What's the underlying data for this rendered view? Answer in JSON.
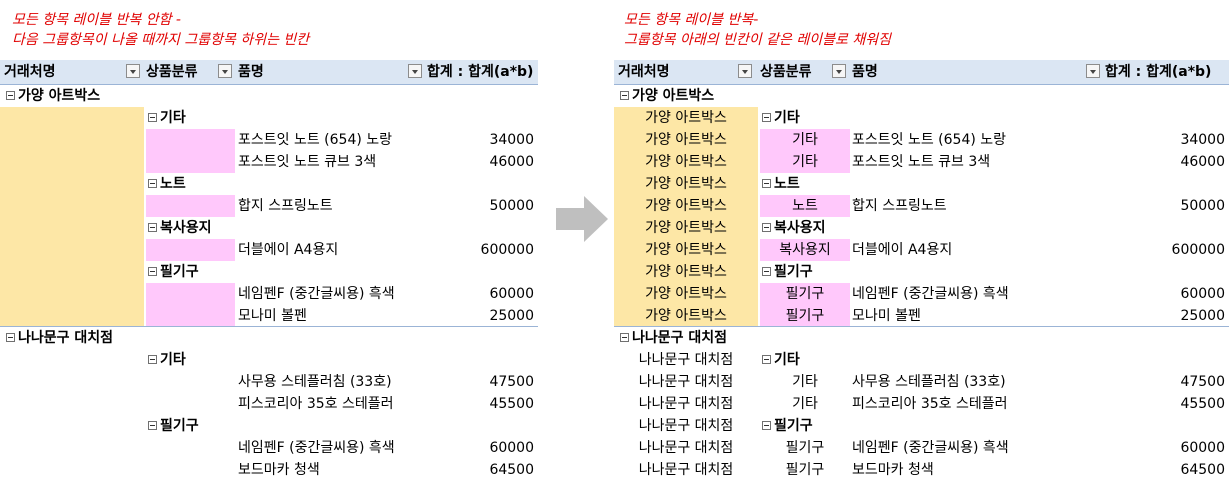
{
  "left_caption": {
    "line1": "모든 항목 레이블 반복 안함 -",
    "line2": "다음 그룹항목이 나올 때까지 그룹항목 하위는 빈칸"
  },
  "right_caption": {
    "line1": "모든 항목 레이블 반복-",
    "line2": "그룹항목 아래의 빈칸이 같은 레이블로 채워짐"
  },
  "headers": {
    "col1": "거래처명",
    "col2": "상품분류",
    "col3": "품명",
    "col4": "합계 : 합계(a*b)"
  },
  "colors": {
    "header_bg": "#dbe6f3",
    "vendor_fill": "#fde7a6",
    "category_fill": "#ffc8fb",
    "caption_text": "#e00000",
    "arrow": "#bfbfbf"
  },
  "arrow_icon": "right-arrow-icon",
  "left_rows": [
    {
      "vendor": "가양 아트박스",
      "category": "",
      "item": "",
      "value": ""
    },
    {
      "vendor": "",
      "category": "기타",
      "item": "",
      "value": ""
    },
    {
      "vendor": "",
      "category": "",
      "item": "포스트잇 노트 (654) 노랑",
      "value": "34000"
    },
    {
      "vendor": "",
      "category": "",
      "item": "포스트잇 노트 큐브 3색",
      "value": "46000"
    },
    {
      "vendor": "",
      "category": "노트",
      "item": "",
      "value": ""
    },
    {
      "vendor": "",
      "category": "",
      "item": "합지 스프링노트",
      "value": "50000"
    },
    {
      "vendor": "",
      "category": "복사용지",
      "item": "",
      "value": ""
    },
    {
      "vendor": "",
      "category": "",
      "item": "더블에이 A4용지",
      "value": "600000"
    },
    {
      "vendor": "",
      "category": "필기구",
      "item": "",
      "value": ""
    },
    {
      "vendor": "",
      "category": "",
      "item": "네임펜F (중간글씨용) 흑색",
      "value": "60000"
    },
    {
      "vendor": "",
      "category": "",
      "item": "모나미 볼펜",
      "value": "25000"
    },
    {
      "vendor": "나나문구 대치점",
      "category": "",
      "item": "",
      "value": ""
    },
    {
      "vendor": "",
      "category": "기타",
      "item": "",
      "value": ""
    },
    {
      "vendor": "",
      "category": "",
      "item": "사무용 스테플러침 (33호)",
      "value": "47500"
    },
    {
      "vendor": "",
      "category": "",
      "item": "피스코리아 35호 스테플러",
      "value": "45500"
    },
    {
      "vendor": "",
      "category": "필기구",
      "item": "",
      "value": ""
    },
    {
      "vendor": "",
      "category": "",
      "item": "네임펜F (중간글씨용) 흑색",
      "value": "60000"
    },
    {
      "vendor": "",
      "category": "",
      "item": "보드마카 청색",
      "value": "64500"
    }
  ],
  "right_rows": [
    {
      "vendor": "가양 아트박스",
      "category": "",
      "item": "",
      "value": ""
    },
    {
      "vendor": "가양 아트박스",
      "category": "기타",
      "item": "",
      "value": ""
    },
    {
      "vendor": "가양 아트박스",
      "category": "기타",
      "item": "포스트잇 노트 (654) 노랑",
      "value": "34000"
    },
    {
      "vendor": "가양 아트박스",
      "category": "기타",
      "item": "포스트잇 노트 큐브 3색",
      "value": "46000"
    },
    {
      "vendor": "가양 아트박스",
      "category": "노트",
      "item": "",
      "value": ""
    },
    {
      "vendor": "가양 아트박스",
      "category": "노트",
      "item": "합지 스프링노트",
      "value": "50000"
    },
    {
      "vendor": "가양 아트박스",
      "category": "복사용지",
      "item": "",
      "value": ""
    },
    {
      "vendor": "가양 아트박스",
      "category": "복사용지",
      "item": "더블에이 A4용지",
      "value": "600000"
    },
    {
      "vendor": "가양 아트박스",
      "category": "필기구",
      "item": "",
      "value": ""
    },
    {
      "vendor": "가양 아트박스",
      "category": "필기구",
      "item": "네임펜F (중간글씨용) 흑색",
      "value": "60000"
    },
    {
      "vendor": "가양 아트박스",
      "category": "필기구",
      "item": "모나미 볼펜",
      "value": "25000"
    },
    {
      "vendor": "나나문구 대치점",
      "category": "",
      "item": "",
      "value": ""
    },
    {
      "vendor": "나나문구 대치점",
      "category": "기타",
      "item": "",
      "value": ""
    },
    {
      "vendor": "나나문구 대치점",
      "category": "기타",
      "item": "사무용 스테플러침 (33호)",
      "value": "47500"
    },
    {
      "vendor": "나나문구 대치점",
      "category": "기타",
      "item": "피스코리아 35호 스테플러",
      "value": "45500"
    },
    {
      "vendor": "나나문구 대치점",
      "category": "필기구",
      "item": "",
      "value": ""
    },
    {
      "vendor": "나나문구 대치점",
      "category": "필기구",
      "item": "네임펜F (중간글씨용) 흑색",
      "value": "60000"
    },
    {
      "vendor": "나나문구 대치점",
      "category": "필기구",
      "item": "보드마카 청색",
      "value": "64500"
    }
  ]
}
